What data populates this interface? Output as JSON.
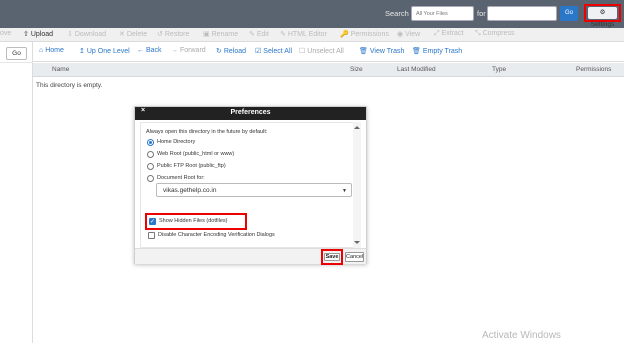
{
  "topbar": {
    "search_label": "Search",
    "search_scope": "All Your Files",
    "for_label": "for",
    "search_value": "",
    "go_label": "Go",
    "settings_label": "Settings"
  },
  "toolbar1": {
    "items": [
      {
        "label": "ove",
        "icon": ""
      },
      {
        "label": "Upload",
        "icon": "⇧"
      },
      {
        "label": "Download",
        "icon": "⇩"
      },
      {
        "label": "Delete",
        "icon": "✕"
      },
      {
        "label": "Restore",
        "icon": "↺"
      },
      {
        "label": "Rename",
        "icon": "▣"
      },
      {
        "label": "Edit",
        "icon": "✎"
      },
      {
        "label": "HTML Editor",
        "icon": "✎"
      },
      {
        "label": "Permissions",
        "icon": "🔑"
      },
      {
        "label": "View",
        "icon": "◉"
      },
      {
        "label": "Extract",
        "icon": "⤢"
      },
      {
        "label": "Compress",
        "icon": "⤡"
      }
    ]
  },
  "sidebar": {
    "go_label": "Go"
  },
  "toolbar2": {
    "items": [
      {
        "label": "Home",
        "icon": "⌂"
      },
      {
        "label": "Up One Level",
        "icon": "↥"
      },
      {
        "label": "Back",
        "icon": "←"
      },
      {
        "label": "Forward",
        "icon": "→"
      },
      {
        "label": "Reload",
        "icon": "↻"
      },
      {
        "label": "Select All",
        "icon": "☑"
      },
      {
        "label": "Unselect All",
        "icon": "☐"
      },
      {
        "label": "View Trash",
        "icon": "🗑"
      },
      {
        "label": "Empty Trash",
        "icon": "🗑"
      }
    ]
  },
  "table": {
    "columns": [
      "Name",
      "Size",
      "Last Modified",
      "Type",
      "Permissions"
    ],
    "empty_message": "This directory is empty."
  },
  "modal": {
    "title": "Preferences",
    "close": "×",
    "intro": "Always open this directory in the future by default:",
    "options": [
      {
        "label": "Home Directory",
        "selected": true
      },
      {
        "label": "Web Root (public_html or www)",
        "selected": false
      },
      {
        "label": "Public FTP Root (public_ftp)",
        "selected": false
      },
      {
        "label": "Document Root for:",
        "selected": false
      }
    ],
    "document_root_value": "vikas.gethelp.co.in",
    "show_hidden_label": "Show Hidden Files (dotfiles)",
    "show_hidden_checked": true,
    "disable_encoding_label": "Disable Character Encoding Verification Dialogs",
    "disable_encoding_checked": false,
    "save_label": "Save",
    "cancel_label": "Cancel"
  },
  "watermark": "Activate Windows",
  "colors": {
    "topbar": "#5a6470",
    "accent": "#2a77c9",
    "highlight": "#e00000",
    "modal_header": "#222222"
  }
}
